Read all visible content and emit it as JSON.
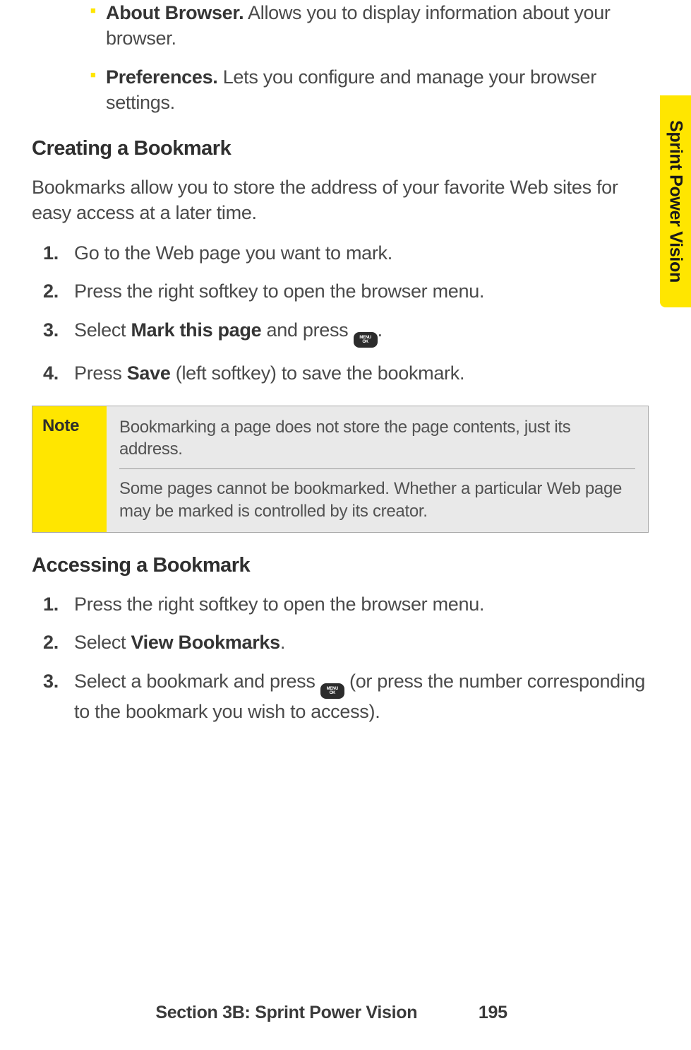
{
  "tab_label": "Sprint Power Vision",
  "top_bullets": [
    {
      "bold": "About Browser.",
      "rest": " Allows you to display information about your browser."
    },
    {
      "bold": "Preferences.",
      "rest": " Lets you configure and manage your browser settings."
    }
  ],
  "section1": {
    "heading": "Creating a Bookmark",
    "intro": "Bookmarks allow you to store the address of your favorite Web sites for easy access at a later time.",
    "steps": [
      {
        "pre": "Go to the Web page you want to mark."
      },
      {
        "pre": "Press the right softkey to open the browser menu."
      },
      {
        "pre": "Select ",
        "bold": "Mark this page",
        "mid": " and press ",
        "icon": true,
        "post": "."
      },
      {
        "pre": "Press ",
        "bold": "Save",
        "post": " (left softkey) to save the bookmark."
      }
    ]
  },
  "note": {
    "label": "Note",
    "p1": "Bookmarking a page does not store the page contents, just its address.",
    "p2": "Some pages cannot be bookmarked. Whether a particular Web page may be marked is controlled by its creator."
  },
  "section2": {
    "heading": "Accessing a Bookmark",
    "steps": [
      {
        "pre": "Press the right softkey to open the browser menu."
      },
      {
        "pre": "Select ",
        "bold": "View Bookmarks",
        "post": "."
      },
      {
        "pre": "Select a bookmark and press ",
        "icon": true,
        "post": " (or press the number corresponding to the bookmark you wish to access)."
      }
    ]
  },
  "footer": {
    "section": "Section 3B: Sprint Power Vision",
    "page": "195"
  },
  "key_label_top": "MENU",
  "key_label_bottom": "OK"
}
